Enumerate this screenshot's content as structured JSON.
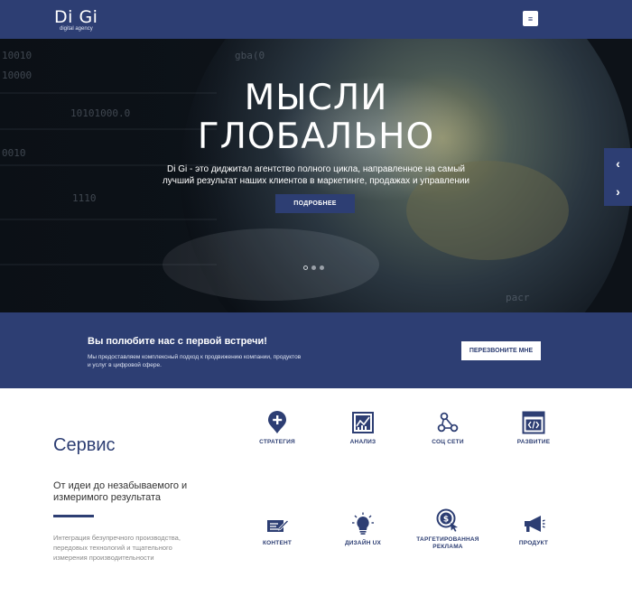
{
  "header": {
    "logo_main": "Di Gi",
    "logo_sub": "digital agency",
    "menu_icon": "hamburger-icon"
  },
  "hero": {
    "title_line1": "МЫСЛИ",
    "title_line2": "ГЛОБАЛЬНО",
    "subtitle": "Di Gi - это диджитал агентство полного цикла, направленное на самый лучший результат наших клиентов в маркетинге, продажах и управлении",
    "button_label": "ПОДРОБНЕЕ",
    "slides_count": 3,
    "active_slide": 1,
    "prev_icon": "chevron-left-icon",
    "next_icon": "chevron-right-icon"
  },
  "cta": {
    "title": "Вы полюбите нас с первой встречи!",
    "text": "Мы предоставляем комплексный подход к продвижению компании, продуктов и услуг в цифровой сфере.",
    "button_label": "ПЕРЕЗВОНИТЕ МНЕ"
  },
  "services": {
    "title": "Сервис",
    "subtitle": "От идеи до незабываемого и измеримого результата",
    "description": "Интеграция безупречного производства, передовых технологий и тщательного измерения производительности",
    "items": [
      {
        "label": "СТРАТЕГИЯ",
        "icon": "pin-plus-icon"
      },
      {
        "label": "АНАЛИЗ",
        "icon": "analytics-chart-icon"
      },
      {
        "label": "СОЦ СЕТИ",
        "icon": "network-nodes-icon"
      },
      {
        "label": "РАЗВИТИЕ",
        "icon": "code-window-icon"
      },
      {
        "label": "КОНТЕНТ",
        "icon": "edit-pencil-icon"
      },
      {
        "label": "ДИЗАЙН UX",
        "icon": "lightbulb-icon"
      },
      {
        "label": "ТАРГЕТИРОВАННАЯ РЕКЛАМА",
        "icon": "dollar-target-icon"
      },
      {
        "label": "ПРОДУКТ",
        "icon": "megaphone-icon"
      }
    ]
  },
  "colors": {
    "brand": "#2d3e73",
    "white": "#ffffff",
    "text_dark": "#333333",
    "text_muted": "#888888"
  }
}
